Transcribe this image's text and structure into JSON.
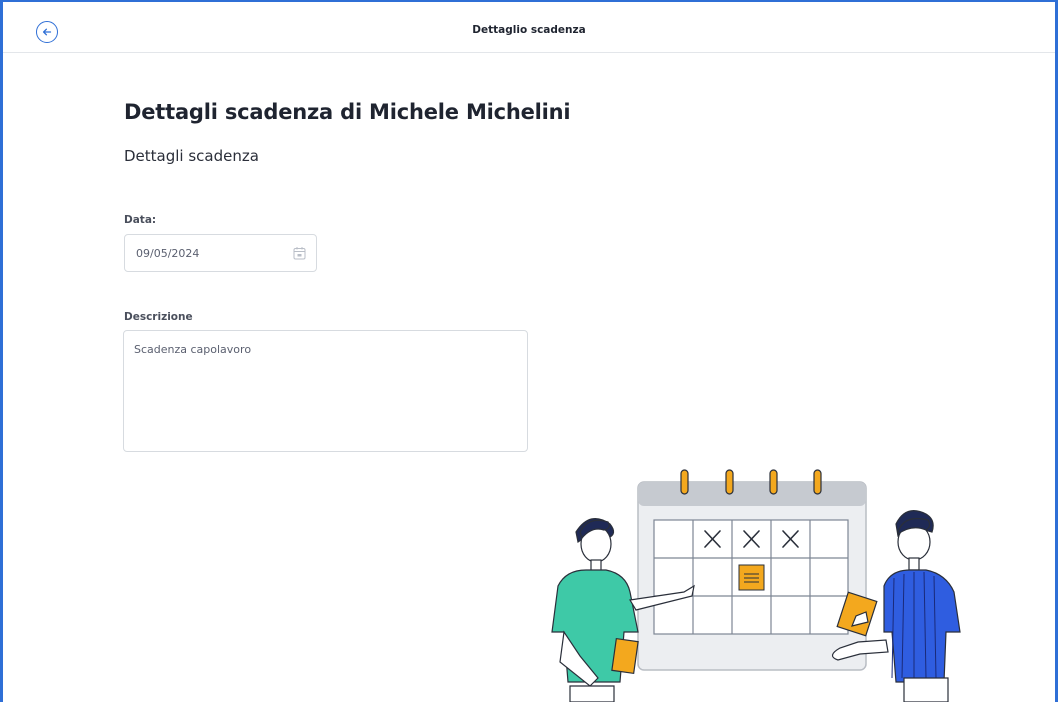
{
  "header": {
    "title": "Dettaglio scadenza"
  },
  "main": {
    "title": "Dettagli scadenza di Michele Michelini",
    "subtitle": "Dettagli scadenza",
    "date_field": {
      "label": "Data:",
      "value": "09/05/2024"
    },
    "description_field": {
      "label": "Descrizione",
      "value": "Scadenza capolavoro"
    }
  },
  "colors": {
    "accent": "#2f6fd6",
    "calendar_ring": "#f0a81c",
    "shirt_left": "#3ec9a7",
    "shirt_right": "#2f5de0"
  },
  "icons": {
    "back": "arrow-left-circle-icon",
    "date": "calendar-icon"
  }
}
